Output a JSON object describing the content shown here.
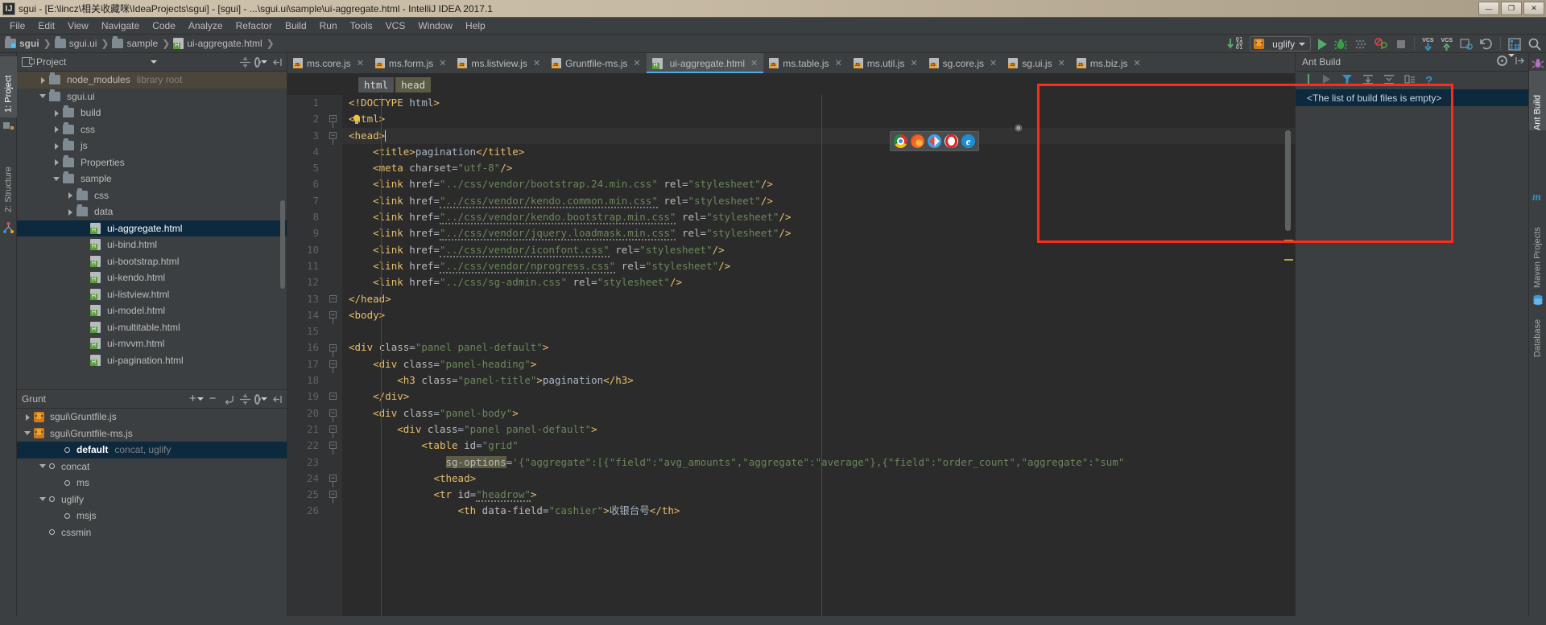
{
  "window": {
    "title": "sgui - [E:\\lincz\\相关收藏咪\\IdeaProjects\\sgui] - [sgui] - ...\\sgui.ui\\sample\\ui-aggregate.html - IntelliJ IDEA 2017.1",
    "icon": "intellij-idea-icon",
    "buttons": [
      "minimize",
      "maximize",
      "close"
    ],
    "minimize_glyph": "—",
    "maximize_glyph": "❐",
    "close_glyph": "✕"
  },
  "menubar": {
    "items": [
      {
        "label": "File"
      },
      {
        "label": "Edit"
      },
      {
        "label": "View"
      },
      {
        "label": "Navigate"
      },
      {
        "label": "Code"
      },
      {
        "label": "Analyze"
      },
      {
        "label": "Refactor"
      },
      {
        "label": "Build"
      },
      {
        "label": "Run"
      },
      {
        "label": "Tools"
      },
      {
        "label": "VCS"
      },
      {
        "label": "Window"
      },
      {
        "label": "Help"
      }
    ]
  },
  "breadcrumb": {
    "items": [
      {
        "label": "sgui",
        "icon": "folder-module-icon"
      },
      {
        "label": "sgui.ui",
        "icon": "folder-icon"
      },
      {
        "label": "sample",
        "icon": "folder-icon"
      },
      {
        "label": "ui-aggregate.html",
        "icon": "html-file-icon"
      }
    ],
    "separator": "❯"
  },
  "toolbar": {
    "items": [
      {
        "name": "compile-icon",
        "label": "01 10 01"
      },
      {
        "name": "run-configuration-selector",
        "label": "uglify",
        "icon": "grunt-icon"
      },
      {
        "name": "run-button",
        "icon": "play-icon"
      },
      {
        "name": "debug-button",
        "icon": "bug-icon"
      },
      {
        "name": "coverage-button",
        "icon": "coverage-icon"
      },
      {
        "name": "stop-profiling-button",
        "icon": "profile-icon"
      },
      {
        "name": "stop-button",
        "icon": "stop-square-icon"
      },
      {
        "name": "vcs-update-button",
        "icon": "vcs-update-icon",
        "label": "VCS"
      },
      {
        "name": "vcs-commit-button",
        "icon": "vcs-commit-icon",
        "label": "VCS"
      },
      {
        "name": "vcs-history-button",
        "icon": "vcs-history-icon"
      },
      {
        "name": "revert-button",
        "icon": "undo-icon"
      },
      {
        "name": "settings-button",
        "icon": "settings-icon"
      },
      {
        "name": "search-everywhere-button",
        "icon": "search-icon"
      }
    ]
  },
  "left_rail": {
    "tabs": [
      {
        "label": "1: Project",
        "selected": true,
        "icon": "project-icon"
      },
      {
        "label": "2: Structure",
        "selected": false,
        "icon": "structure-icon"
      }
    ]
  },
  "right_rail": {
    "tabs": [
      {
        "label": "Ant Build",
        "selected": true,
        "icon": "ant-icon"
      },
      {
        "label": "Maven Projects",
        "selected": false,
        "icon": "maven-icon"
      },
      {
        "label": "Database",
        "selected": false,
        "icon": "database-icon"
      }
    ]
  },
  "project_panel": {
    "title": "Project",
    "title_icon": "project-view-icon",
    "header_buttons": [
      {
        "name": "expand-collapse-icon",
        "glyph": "⇳"
      },
      {
        "name": "gear-icon",
        "glyph": "⚙"
      },
      {
        "name": "hide-panel-icon",
        "glyph": "⇤"
      }
    ],
    "tree": [
      {
        "label": "node_modules",
        "suffix": "library root",
        "indent": 1,
        "arrow": "closed",
        "icon": "folder-icon",
        "highlight": "library"
      },
      {
        "label": "sgui.ui",
        "indent": 1,
        "arrow": "open",
        "icon": "folder-icon"
      },
      {
        "label": "build",
        "indent": 2,
        "arrow": "closed",
        "icon": "folder-icon"
      },
      {
        "label": "css",
        "indent": 2,
        "arrow": "closed",
        "icon": "folder-icon"
      },
      {
        "label": "js",
        "indent": 2,
        "arrow": "closed",
        "icon": "folder-icon"
      },
      {
        "label": "Properties",
        "indent": 2,
        "arrow": "closed",
        "icon": "folder-icon"
      },
      {
        "label": "sample",
        "indent": 2,
        "arrow": "open",
        "icon": "folder-icon"
      },
      {
        "label": "css",
        "indent": 3,
        "arrow": "closed",
        "icon": "folder-icon"
      },
      {
        "label": "data",
        "indent": 3,
        "arrow": "closed",
        "icon": "folder-icon"
      },
      {
        "label": "ui-aggregate.html",
        "indent": 4,
        "arrow": "none",
        "icon": "html-file-icon",
        "selected": true
      },
      {
        "label": "ui-bind.html",
        "indent": 4,
        "arrow": "none",
        "icon": "html-file-icon"
      },
      {
        "label": "ui-bootstrap.html",
        "indent": 4,
        "arrow": "none",
        "icon": "html-file-icon"
      },
      {
        "label": "ui-kendo.html",
        "indent": 4,
        "arrow": "none",
        "icon": "html-file-icon"
      },
      {
        "label": "ui-listview.html",
        "indent": 4,
        "arrow": "none",
        "icon": "html-file-icon"
      },
      {
        "label": "ui-model.html",
        "indent": 4,
        "arrow": "none",
        "icon": "html-file-icon"
      },
      {
        "label": "ui-multitable.html",
        "indent": 4,
        "arrow": "none",
        "icon": "html-file-icon"
      },
      {
        "label": "ui-mvvm.html",
        "indent": 4,
        "arrow": "none",
        "icon": "html-file-icon"
      },
      {
        "label": "ui-pagination.html",
        "indent": 4,
        "arrow": "none",
        "icon": "html-file-icon"
      }
    ]
  },
  "grunt_panel": {
    "title": "Grunt",
    "header_buttons": [
      {
        "name": "add-icon",
        "glyph": "+"
      },
      {
        "name": "remove-icon",
        "glyph": "−"
      },
      {
        "name": "rerun-icon",
        "glyph": "↱"
      },
      {
        "name": "expand-collapse-icon",
        "glyph": "⇳"
      },
      {
        "name": "gear-icon",
        "glyph": "⚙"
      },
      {
        "name": "hide-panel-icon",
        "glyph": "⇤"
      }
    ],
    "tree": [
      {
        "label": "sgui\\Gruntfile.js",
        "indent": 0,
        "arrow": "closed",
        "icon": "grunt-icon"
      },
      {
        "label": "sgui\\Gruntfile-ms.js",
        "indent": 0,
        "arrow": "open",
        "icon": "grunt-icon"
      },
      {
        "label": "default",
        "suffix": "concat, uglify",
        "indent": 2,
        "arrow": "none",
        "icon": "task-icon",
        "selected": true,
        "bold": true
      },
      {
        "label": "concat",
        "indent": 1,
        "arrow": "open",
        "icon": "task-icon"
      },
      {
        "label": "ms",
        "indent": 2,
        "arrow": "none",
        "icon": "task-icon"
      },
      {
        "label": "uglify",
        "indent": 1,
        "arrow": "open",
        "icon": "task-icon"
      },
      {
        "label": "msjs",
        "indent": 2,
        "arrow": "none",
        "icon": "task-icon"
      },
      {
        "label": "cssmin",
        "indent": 1,
        "arrow": "none",
        "icon": "task-icon"
      }
    ]
  },
  "editor": {
    "tabs": [
      {
        "label": "ms.core.js",
        "icon": "js-file-icon",
        "active": false
      },
      {
        "label": "ms.form.js",
        "icon": "js-file-icon",
        "active": false
      },
      {
        "label": "ms.listview.js",
        "icon": "js-file-icon",
        "active": false
      },
      {
        "label": "Gruntfile-ms.js",
        "icon": "js-file-icon",
        "active": false
      },
      {
        "label": "ui-aggregate.html",
        "icon": "html-file-icon",
        "active": true
      },
      {
        "label": "ms.table.js",
        "icon": "js-file-icon",
        "active": false
      },
      {
        "label": "ms.util.js",
        "icon": "js-file-icon",
        "active": false
      },
      {
        "label": "sg.core.js",
        "icon": "js-file-icon",
        "active": false
      },
      {
        "label": "sg.ui.js",
        "icon": "js-file-icon",
        "active": false
      },
      {
        "label": "ms.biz.js",
        "icon": "js-file-icon",
        "active": false
      }
    ],
    "tab_close_glyph": "✕",
    "breadcrumbs": [
      {
        "label": "html",
        "active": true
      },
      {
        "label": "head",
        "active": false
      }
    ],
    "browser_popup": {
      "browsers": [
        {
          "name": "chrome-icon"
        },
        {
          "name": "firefox-icon"
        },
        {
          "name": "safari-icon"
        },
        {
          "name": "opera-icon"
        },
        {
          "name": "edge-icon",
          "glyph": "e"
        }
      ]
    },
    "preview_eye_glyph": "◉",
    "first_line": 1,
    "lines": [
      {
        "n": 1,
        "fold": "none",
        "text": "<!DOCTYPE html>"
      },
      {
        "n": 2,
        "fold": "start",
        "text": "<html>"
      },
      {
        "n": 3,
        "fold": "start",
        "text": "<head>",
        "cursor": true
      },
      {
        "n": 4,
        "fold": "none",
        "text": "    <title>pagination</title>"
      },
      {
        "n": 5,
        "fold": "none",
        "text": "    <meta charset=\"utf-8\"/>"
      },
      {
        "n": 6,
        "fold": "none",
        "text": "    <link href=\"../css/vendor/bootstrap.24.min.css\" rel=\"stylesheet\"/>"
      },
      {
        "n": 7,
        "fold": "none",
        "text": "    <link href=\"../css/vendor/kendo.common.min.css\" rel=\"stylesheet\"/>"
      },
      {
        "n": 8,
        "fold": "none",
        "text": "    <link href=\"../css/vendor/kendo.bootstrap.min.css\" rel=\"stylesheet\"/>"
      },
      {
        "n": 9,
        "fold": "none",
        "text": "    <link href=\"../css/vendor/jquery.loadmask.min.css\" rel=\"stylesheet\"/>"
      },
      {
        "n": 10,
        "fold": "none",
        "text": "    <link href=\"../css/vendor/iconfont.css\" rel=\"stylesheet\"/>"
      },
      {
        "n": 11,
        "fold": "none",
        "text": "    <link href=\"../css/vendor/nprogress.css\" rel=\"stylesheet\"/>"
      },
      {
        "n": 12,
        "fold": "none",
        "text": "    <link href=\"../css/sg-admin.css\" rel=\"stylesheet\"/>"
      },
      {
        "n": 13,
        "fold": "end",
        "text": "</head>"
      },
      {
        "n": 14,
        "fold": "start",
        "text": "<body>"
      },
      {
        "n": 15,
        "fold": "none",
        "text": ""
      },
      {
        "n": 16,
        "fold": "start",
        "text": "<div class=\"panel panel-default\">"
      },
      {
        "n": 17,
        "fold": "start",
        "text": "    <div class=\"panel-heading\">"
      },
      {
        "n": 18,
        "fold": "none",
        "text": "        <h3 class=\"panel-title\">pagination</h3>"
      },
      {
        "n": 19,
        "fold": "end",
        "text": "    </div>"
      },
      {
        "n": 20,
        "fold": "start",
        "text": "    <div class=\"panel-body\">"
      },
      {
        "n": 21,
        "fold": "start",
        "text": "        <div class=\"panel panel-default\">"
      },
      {
        "n": 22,
        "fold": "start",
        "text": "            <table id=\"grid\""
      },
      {
        "n": 23,
        "fold": "none",
        "text": "                sg-options='{\"aggregate\":[{\"field\":\"avg_amounts\",\"aggregate\":\"average\"},{\"field\":\"order_count\",\"aggregate\":\"sum\""
      },
      {
        "n": 24,
        "fold": "start",
        "text": "              <thead>"
      },
      {
        "n": 25,
        "fold": "start",
        "text": "              <tr id=\"headrow\">"
      },
      {
        "n": 26,
        "fold": "none",
        "text": "                  <th data-field=\"cashier\">收银台号</th>"
      }
    ]
  },
  "ant_panel": {
    "title": "Ant Build",
    "header_buttons": [
      {
        "name": "gear-icon",
        "glyph": "⚙"
      },
      {
        "name": "hide-panel-icon",
        "glyph": "⇥"
      }
    ],
    "toolbar_buttons": [
      {
        "name": "add-build-file-icon",
        "glyph": "|"
      },
      {
        "name": "run-build-icon",
        "glyph": "▶"
      },
      {
        "name": "filter-targets-icon",
        "glyph": "▼"
      },
      {
        "name": "expand-all-icon",
        "glyph": "⇊"
      },
      {
        "name": "collapse-all-icon",
        "glyph": "⇈"
      },
      {
        "name": "properties-icon",
        "glyph": "▤"
      },
      {
        "name": "help-icon",
        "glyph": "?"
      }
    ],
    "empty_message": "<The list of build files is empty>"
  },
  "annotation": {
    "redbox_color": "#ff2a1c"
  },
  "colors": {
    "accent": "#4eade5",
    "selection": "#0d293e",
    "background": "#3c3f41",
    "editor_background": "#2b2b2b",
    "text": "#bbbbbb",
    "string": "#6a8759",
    "tag": "#e8bf6a"
  }
}
